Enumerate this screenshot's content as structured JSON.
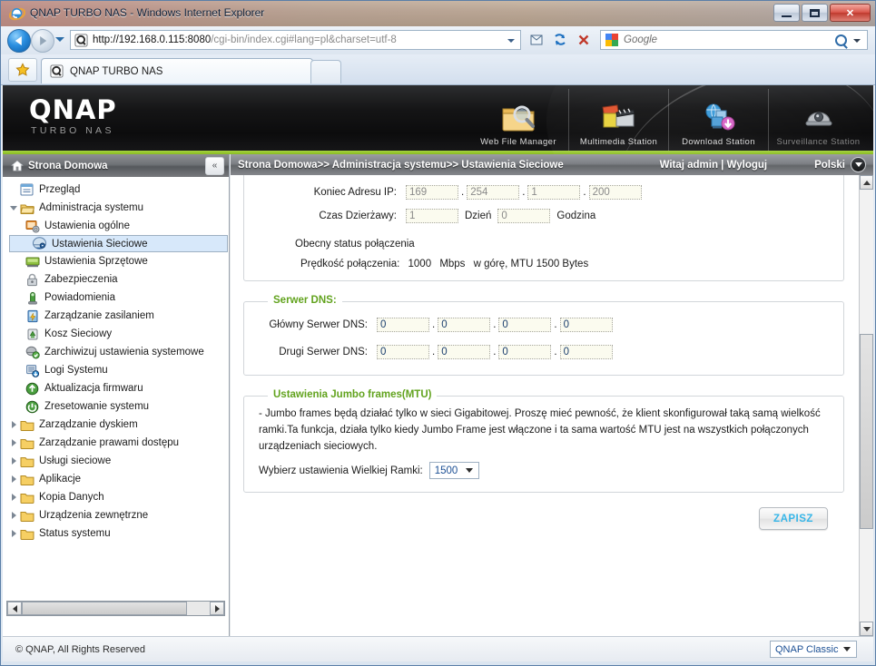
{
  "window": {
    "title": "QNAP TURBO NAS - Windows Internet Explorer",
    "minimize_label": "Minimize",
    "maximize_label": "Maximize",
    "close_label": "✕"
  },
  "browser": {
    "address": "http://192.168.0.115:8080/cgi-bin/index.cgi#lang=pl&charset=utf-8",
    "address_host": "http://192.168.0.115:8080",
    "address_path": "/cgi-bin/index.cgi#lang=pl&charset=utf-8",
    "search_placeholder": "Google",
    "tab_label": "QNAP TURBO NAS",
    "new_tab_label": "",
    "favorites_label": "Favorites"
  },
  "banner": {
    "logo": "QNAP",
    "subtitle": "TURBO NAS",
    "stations": [
      {
        "label": "Web File Manager",
        "icon": "folder-magnifier-icon",
        "enabled": true
      },
      {
        "label": "Multimedia Station",
        "icon": "photo-clapboard-icon",
        "enabled": true
      },
      {
        "label": "Download Station",
        "icon": "globe-download-icon",
        "enabled": true
      },
      {
        "label": "Surveillance Station",
        "icon": "dome-camera-icon",
        "enabled": false
      }
    ]
  },
  "sidebar": {
    "home_label": "Strona Domowa",
    "collapse_label": "«",
    "items": [
      {
        "label": "Przegląd",
        "level": 1,
        "icon": "overview-icon",
        "arrow": "none",
        "selected": false
      },
      {
        "label": "Administracja systemu",
        "level": 1,
        "icon": "folder-open-icon",
        "arrow": "open",
        "selected": false
      },
      {
        "label": "Ustawienia ogólne",
        "level": 2,
        "icon": "general-settings-icon",
        "selected": false
      },
      {
        "label": "Ustawienia Sieciowe",
        "level": 2,
        "icon": "network-settings-icon",
        "selected": true
      },
      {
        "label": "Ustawienia Sprzętowe",
        "level": 2,
        "icon": "hardware-icon",
        "selected": false
      },
      {
        "label": "Zabezpieczenia",
        "level": 2,
        "icon": "lock-icon",
        "selected": false
      },
      {
        "label": "Powiadomienia",
        "level": 2,
        "icon": "notification-icon",
        "selected": false
      },
      {
        "label": "Zarządzanie zasilaniem",
        "level": 2,
        "icon": "power-icon",
        "selected": false
      },
      {
        "label": "Kosz Sieciowy",
        "level": 2,
        "icon": "recycle-bin-icon",
        "selected": false
      },
      {
        "label": "Zarchiwizuj ustawienia systemowe",
        "level": 2,
        "icon": "backup-settings-icon",
        "selected": false
      },
      {
        "label": "Logi Systemu",
        "level": 2,
        "icon": "system-log-icon",
        "selected": false
      },
      {
        "label": "Aktualizacja firmwaru",
        "level": 2,
        "icon": "firmware-update-icon",
        "selected": false
      },
      {
        "label": "Zresetowanie systemu",
        "level": 2,
        "icon": "system-reset-icon",
        "selected": false
      },
      {
        "label": "Zarządzanie dyskiem",
        "level": 1,
        "icon": "folder-icon",
        "arrow": "closed",
        "selected": false
      },
      {
        "label": "Zarządzanie prawami dostępu",
        "level": 1,
        "icon": "folder-icon",
        "arrow": "closed",
        "selected": false
      },
      {
        "label": "Usługi sieciowe",
        "level": 1,
        "icon": "folder-icon",
        "arrow": "closed",
        "selected": false
      },
      {
        "label": "Aplikacje",
        "level": 1,
        "icon": "folder-icon",
        "arrow": "closed",
        "selected": false
      },
      {
        "label": "Kopia Danych",
        "level": 1,
        "icon": "folder-icon",
        "arrow": "closed",
        "selected": false
      },
      {
        "label": "Urządzenia zewnętrzne",
        "level": 1,
        "icon": "folder-icon",
        "arrow": "closed",
        "selected": false
      },
      {
        "label": "Status systemu",
        "level": 1,
        "icon": "folder-icon",
        "arrow": "closed",
        "selected": false
      }
    ]
  },
  "breadcrumb": {
    "text": "Strona Domowa>> Administracja systemu>> Ustawienia Sieciowe",
    "welcome": "Witaj admin | Wyloguj",
    "language": "Polski"
  },
  "dhcp_section": {
    "end_ip_label": "Koniec Adresu IP:",
    "end_ip": [
      "169",
      "254",
      "1",
      "200"
    ],
    "lease_label": "Czas Dzierżawy:",
    "lease_days": "1",
    "lease_days_unit": "Dzień",
    "lease_hours": "0",
    "lease_hours_unit": "Godzina",
    "status_heading": "Obecny status połączenia",
    "speed_label": "Prędkość połączenia:",
    "speed_value": "1000",
    "speed_unit": "Mbps",
    "speed_rest": "w górę, MTU 1500 Bytes"
  },
  "dns_section": {
    "legend": "Serwer DNS:",
    "primary_label": "Główny Serwer DNS:",
    "primary": [
      "0",
      "0",
      "0",
      "0"
    ],
    "secondary_label": "Drugi Serwer DNS:",
    "secondary": [
      "0",
      "0",
      "0",
      "0"
    ]
  },
  "jumbo_section": {
    "legend": "Ustawienia Jumbo frames(MTU)",
    "description": "- Jumbo frames będą działać tylko w sieci Gigabitowej. Proszę mieć pewność, że klient skonfigurował taką samą wielkość ramki.Ta funkcja, działa tylko kiedy Jumbo Frame jest włączone i ta sama wartość MTU jest na wszystkich połączonych urządzeniach sieciowych.",
    "select_label": "Wybierz ustawienia Wielkiej Ramki:",
    "select_value": "1500"
  },
  "actions": {
    "save_label": "ZAPISZ"
  },
  "footer": {
    "copyright": "© QNAP, All Rights Reserved",
    "theme_value": "QNAP Classic"
  },
  "colors": {
    "accent_green": "#62a31e",
    "banner_rule": "#a6d33f",
    "selection_blue": "#d7e8fa",
    "save_text": "#37b6e8"
  }
}
